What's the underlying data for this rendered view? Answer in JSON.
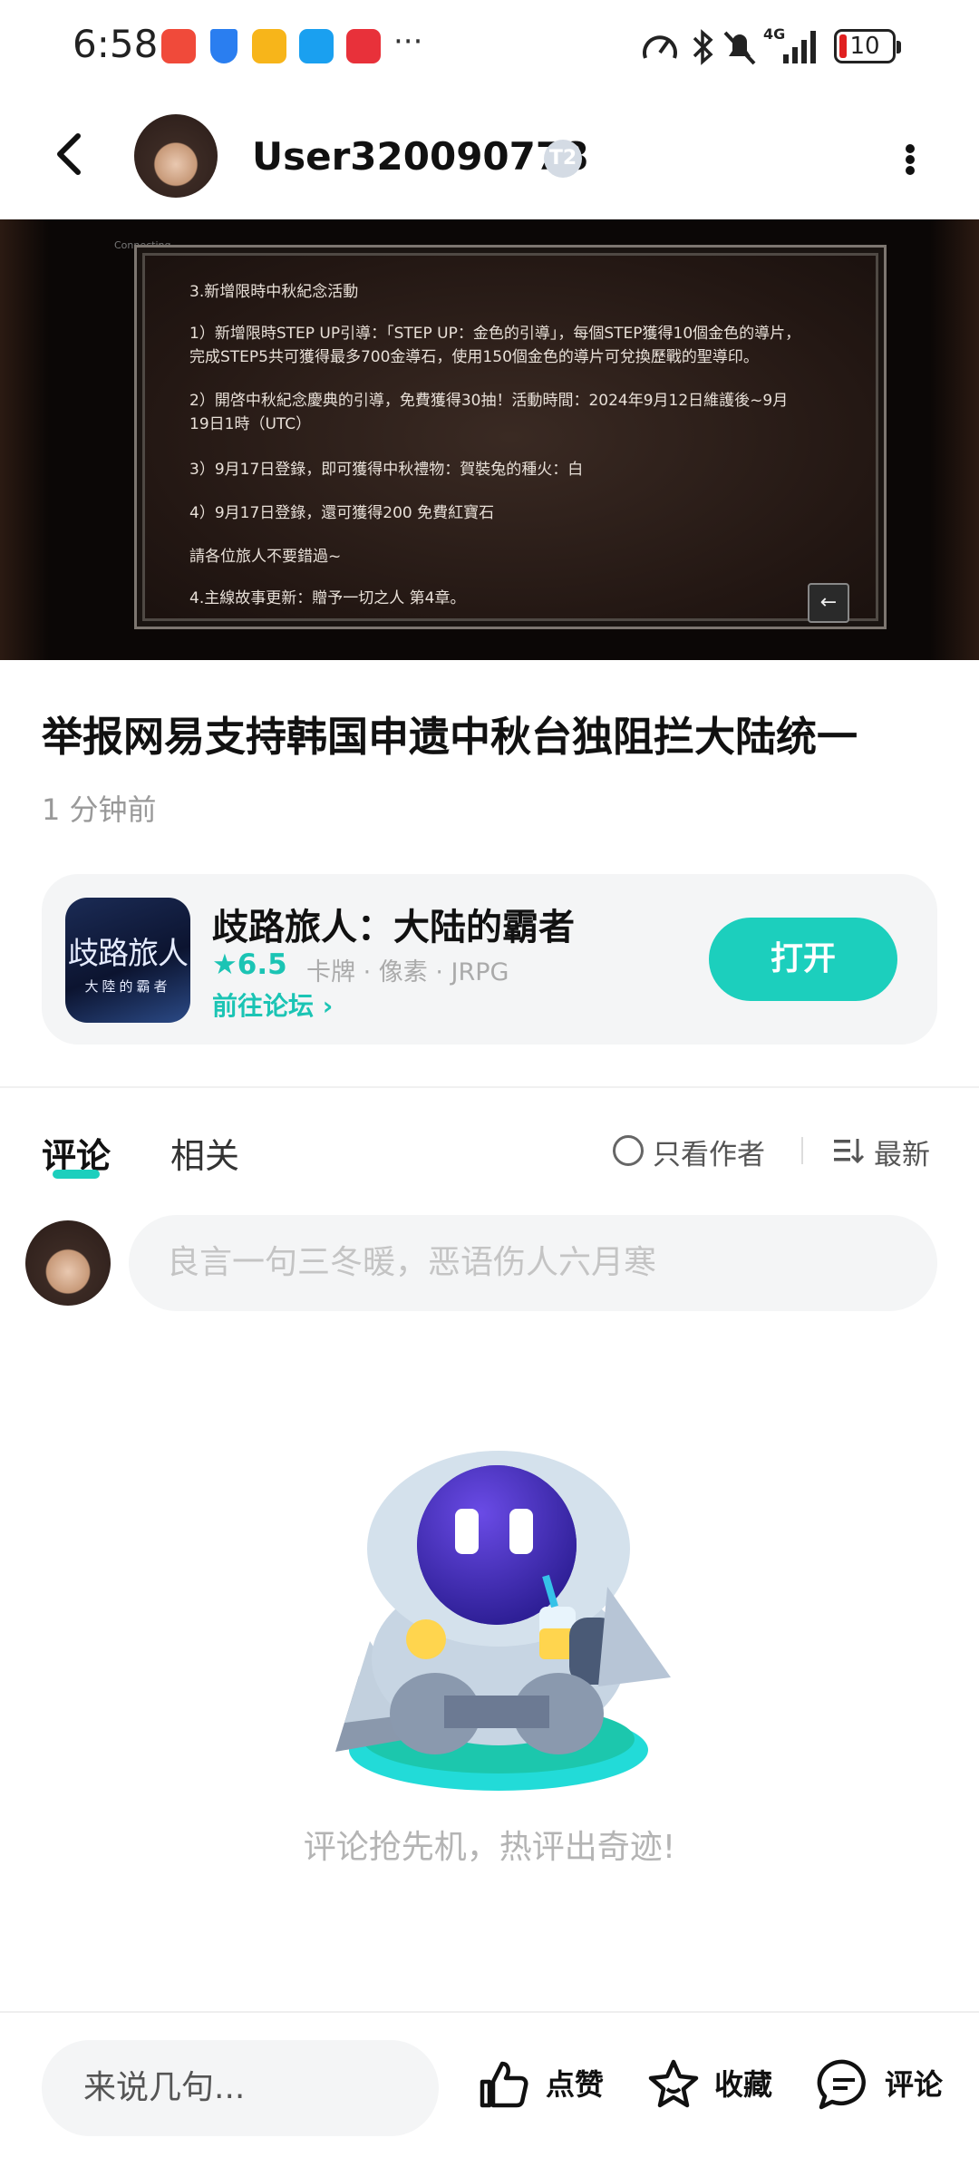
{
  "status_bar": {
    "time": "6:58",
    "more_dots": "···",
    "network": "4G",
    "battery": "10"
  },
  "header": {
    "username": "User320090778",
    "badge": "T2"
  },
  "banner": {
    "watermark": "Connecting...",
    "lines": [
      "3.新增限時中秋紀念活動",
      "1）新增限時STEP UP引導：「STEP UP：金色的引導」，每個STEP獲得10個金色的導片，",
      "完成STEP5共可獲得最多700金導石，使用150個金色的導片可兌換歷戰的聖導印。",
      "2）開啓中秋紀念慶典的引導，免費獲得30抽！活動時間：2024年9月12日維護後~9月",
      "19日1時（UTC）",
      "3）9月17日登錄，即可獲得中秋禮物：賀裝兔的種火：白",
      "4）9月17日登錄，還可獲得200 免費紅寶石",
      "請各位旅人不要錯過~",
      "4.主線故事更新：贈予一切之人 第4章。"
    ],
    "back_glyph": "←"
  },
  "post": {
    "title": "举报网易支持韩国申遗中秋台独阻拦大陆统一",
    "time_ago": "1 分钟前"
  },
  "app_card": {
    "icon_line1": "歧路旅人",
    "icon_line2": "大陸的霸者",
    "name": "歧路旅人：大陆的霸者",
    "rating": "6.5",
    "tags": "卡牌 · 像素 · JRPG",
    "forum_link": "前往论坛",
    "open_button": "打开"
  },
  "tabs": {
    "comments": "评论",
    "related": "相关",
    "author_only": "只看作者",
    "sort": "最新"
  },
  "comment_box": {
    "placeholder": "良言一句三冬暖，恶语伤人六月寒"
  },
  "empty_state": {
    "text": "评论抢先机，热评出奇迹!"
  },
  "bottom_bar": {
    "input_placeholder": "来说几句...",
    "like": "点赞",
    "favorite": "收藏",
    "comment": "评论"
  }
}
